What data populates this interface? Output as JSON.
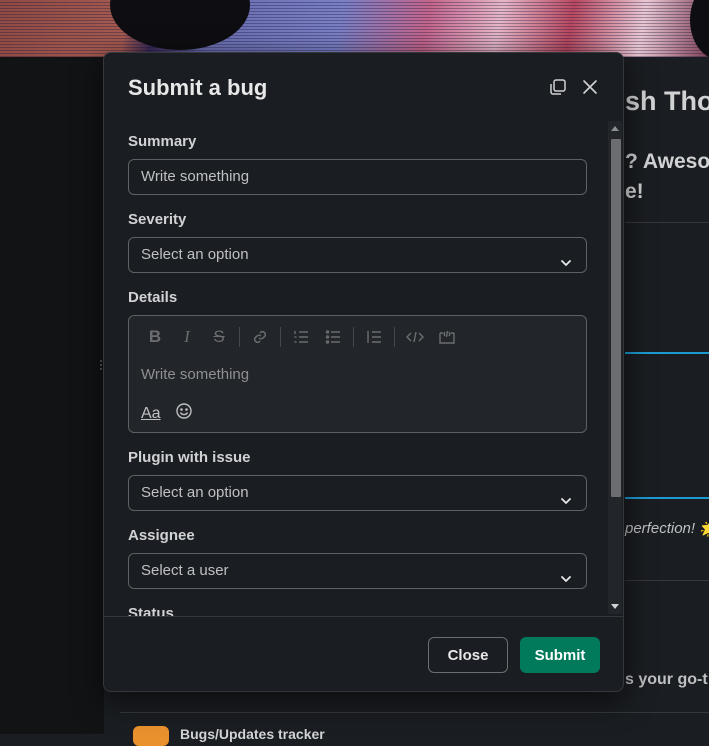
{
  "background": {
    "channel_title": "sh Thos",
    "line1": "? Awesor",
    "line2": "e!",
    "italic_snippet": "perfection! 🌟",
    "goto_snippet": "s your go-t",
    "tracker_name": "Bugs/Updates tracker"
  },
  "modal": {
    "title": "Submit a bug",
    "fields": {
      "summary": {
        "label": "Summary",
        "value": "Write something"
      },
      "severity": {
        "label": "Severity",
        "value": "Select an option"
      },
      "details": {
        "label": "Details",
        "placeholder": "Write something",
        "format_label": "Aa"
      },
      "plugin": {
        "label": "Plugin with issue",
        "value": "Select an option"
      },
      "assignee": {
        "label": "Assignee",
        "value": "Select a user"
      },
      "status": {
        "label": "Status"
      }
    },
    "buttons": {
      "close": "Close",
      "submit": "Submit"
    }
  },
  "colors": {
    "submit": "#007a5a",
    "background": "#1a1d21",
    "border": "#5e6063"
  }
}
